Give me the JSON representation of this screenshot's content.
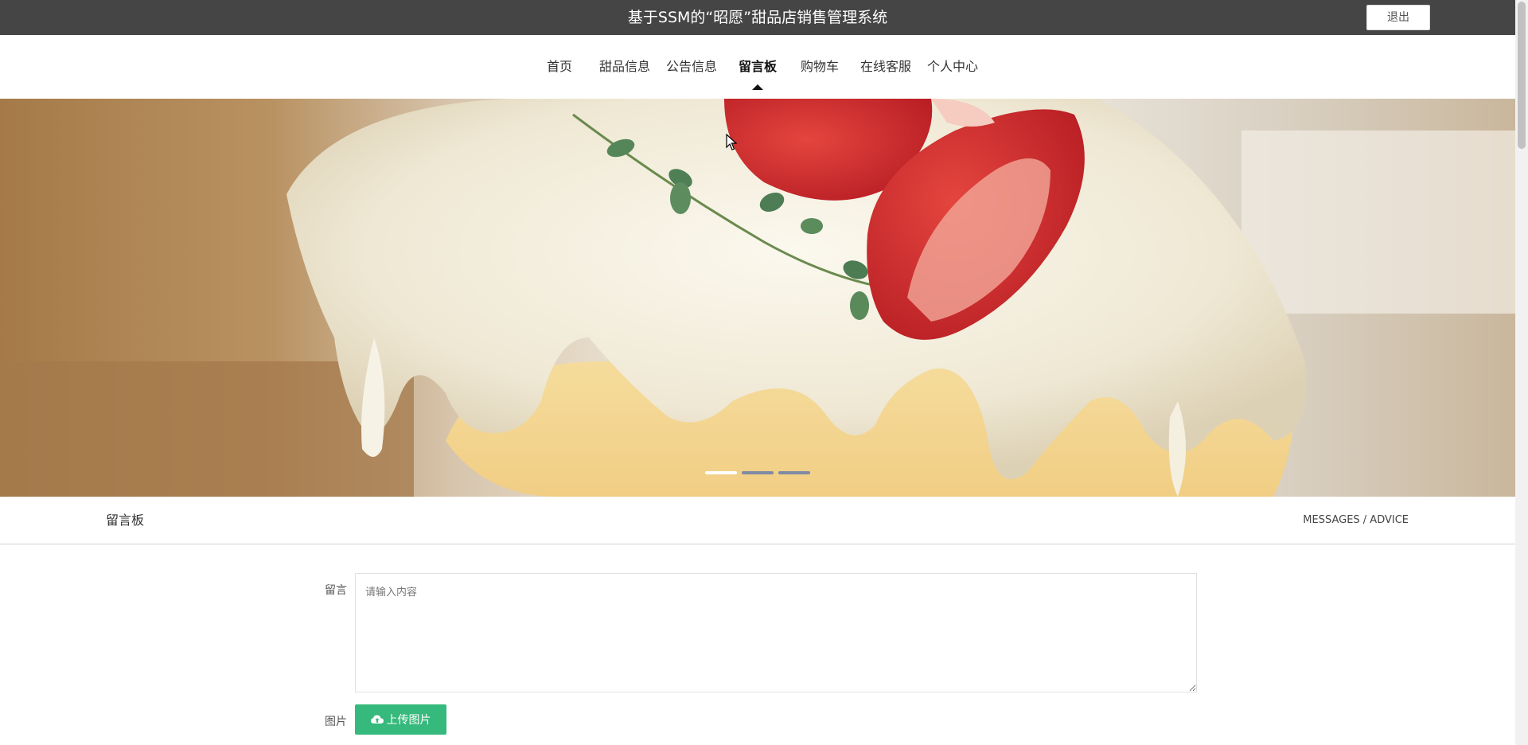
{
  "header": {
    "title": "基于SSM的“昭愿”甜品店销售管理系统",
    "logout_label": "退出"
  },
  "nav": {
    "items": [
      {
        "label": "首页",
        "active": false
      },
      {
        "label": "甜品信息",
        "active": false
      },
      {
        "label": "公告信息",
        "active": false
      },
      {
        "label": "留言板",
        "active": true
      },
      {
        "label": "购物车",
        "active": false
      },
      {
        "label": "在线客服",
        "active": false
      },
      {
        "label": "个人中心",
        "active": false
      }
    ]
  },
  "banner": {
    "image": "strawberry-cream-roll-cake",
    "slide_count": 3,
    "active_slide": 1
  },
  "section": {
    "title": "留言板",
    "subtitle": "MESSAGES / ADVICE"
  },
  "form": {
    "message_label": "留言",
    "message_placeholder": "请输入内容",
    "message_value": "",
    "image_label": "图片",
    "upload_label": "上传图片",
    "upload_icon": "cloud-upload-icon"
  },
  "colors": {
    "topbar": "#454545",
    "upload_button": "#36b97c",
    "active_dot": "#ffffff",
    "inactive_dot": "#7f8aa3"
  }
}
